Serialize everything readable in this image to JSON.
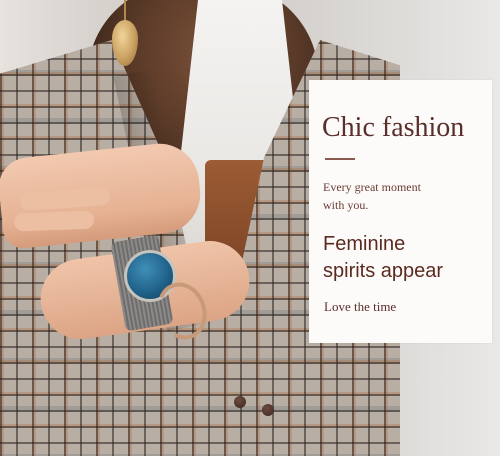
{
  "panel": {
    "headline": "Chic fashion",
    "subtitle_lines": [
      "Every great moment",
      "with you."
    ],
    "tagline_lines": [
      "Feminine",
      "spirits appear"
    ],
    "footer": "Love the time"
  },
  "colors": {
    "text_brown": "#5a2e2a",
    "panel_bg": "#fdfbfa",
    "watch_face_blue": "#1f5f87"
  }
}
